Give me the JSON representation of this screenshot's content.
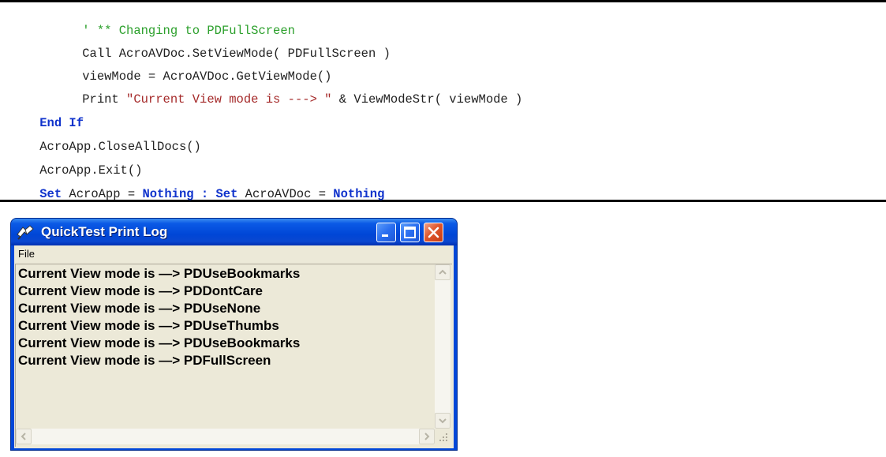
{
  "code": {
    "line1": "' ** Changing to PDFullScreen",
    "line2": "Call AcroAVDoc.SetViewMode( PDFullScreen )",
    "line3": "viewMode = AcroAVDoc.GetViewMode()",
    "line4_a": "Print ",
    "line4_str": "\"Current View mode is ---> \"",
    "line4_b": " & ViewModeStr( viewMode )",
    "line5": "End If",
    "line6": "AcroApp.CloseAllDocs()",
    "line7": "AcroApp.Exit()",
    "line8_set1": "Set",
    "line8_a": " AcroApp = ",
    "line8_nothing1": "Nothing : Set",
    "line8_b": " AcroAVDoc = ",
    "line8_nothing2": "Nothing"
  },
  "window": {
    "title": "QuickTest Print Log",
    "icon": "quicktest-app-icon",
    "menu": {
      "file_label": "File"
    },
    "log_lines": [
      "Current View mode is —> PDUseBookmarks",
      "Current View mode is —> PDDontCare",
      "Current View mode is —> PDUseNone",
      "Current View mode is —> PDUseThumbs",
      "Current View mode is —> PDUseBookmarks",
      "Current View mode is —> PDFullScreen"
    ]
  }
}
